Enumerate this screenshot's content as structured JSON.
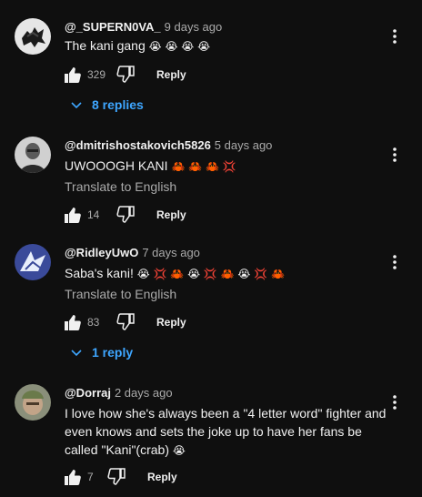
{
  "comments": [
    {
      "author": "@_SUPERN0VA_",
      "time": "9 days ago",
      "text": "The kani gang",
      "emoji": "😭 😭 😭 😭",
      "likes": "329",
      "reply_label": "Reply",
      "replies_label": "8 replies",
      "avatar_icon": "dark-creature-avatar"
    },
    {
      "author": "@dmitrishostakovich5826",
      "time": "5 days ago",
      "text": "UWOOOGH KANI",
      "emoji": "🦀 🦀 🦀 💢",
      "translate_label": "Translate to English",
      "likes": "14",
      "reply_label": "Reply",
      "avatar_icon": "portrait-avatar"
    },
    {
      "author": "@RidleyUwO",
      "time": "7 days ago",
      "text": "Saba's kani!",
      "emoji": "😭 💢 🦀 😭 💢 🦀 😭 💢 🦀",
      "translate_label": "Translate to English",
      "likes": "83",
      "reply_label": "Reply",
      "replies_label": "1 reply",
      "avatar_icon": "shark-avatar"
    },
    {
      "author": "@Dorraj",
      "time": "2 days ago",
      "text": "I love how she's always been a \"4 letter word\" fighter and even knows and sets the joke up to have her fans be called \"Kani\"(crab)",
      "emoji": "😭",
      "likes": "7",
      "reply_label": "Reply",
      "avatar_icon": "photo-avatar"
    }
  ],
  "icons": {
    "like": "thumbs-up-icon",
    "dislike": "thumbs-down-icon",
    "menu": "more-vert-icon",
    "expand": "chevron-down-icon"
  },
  "colors": {
    "background": "#0f0f0f",
    "text": "#f1f1f1",
    "secondary": "#aaaaaa",
    "link": "#3ea6ff"
  }
}
